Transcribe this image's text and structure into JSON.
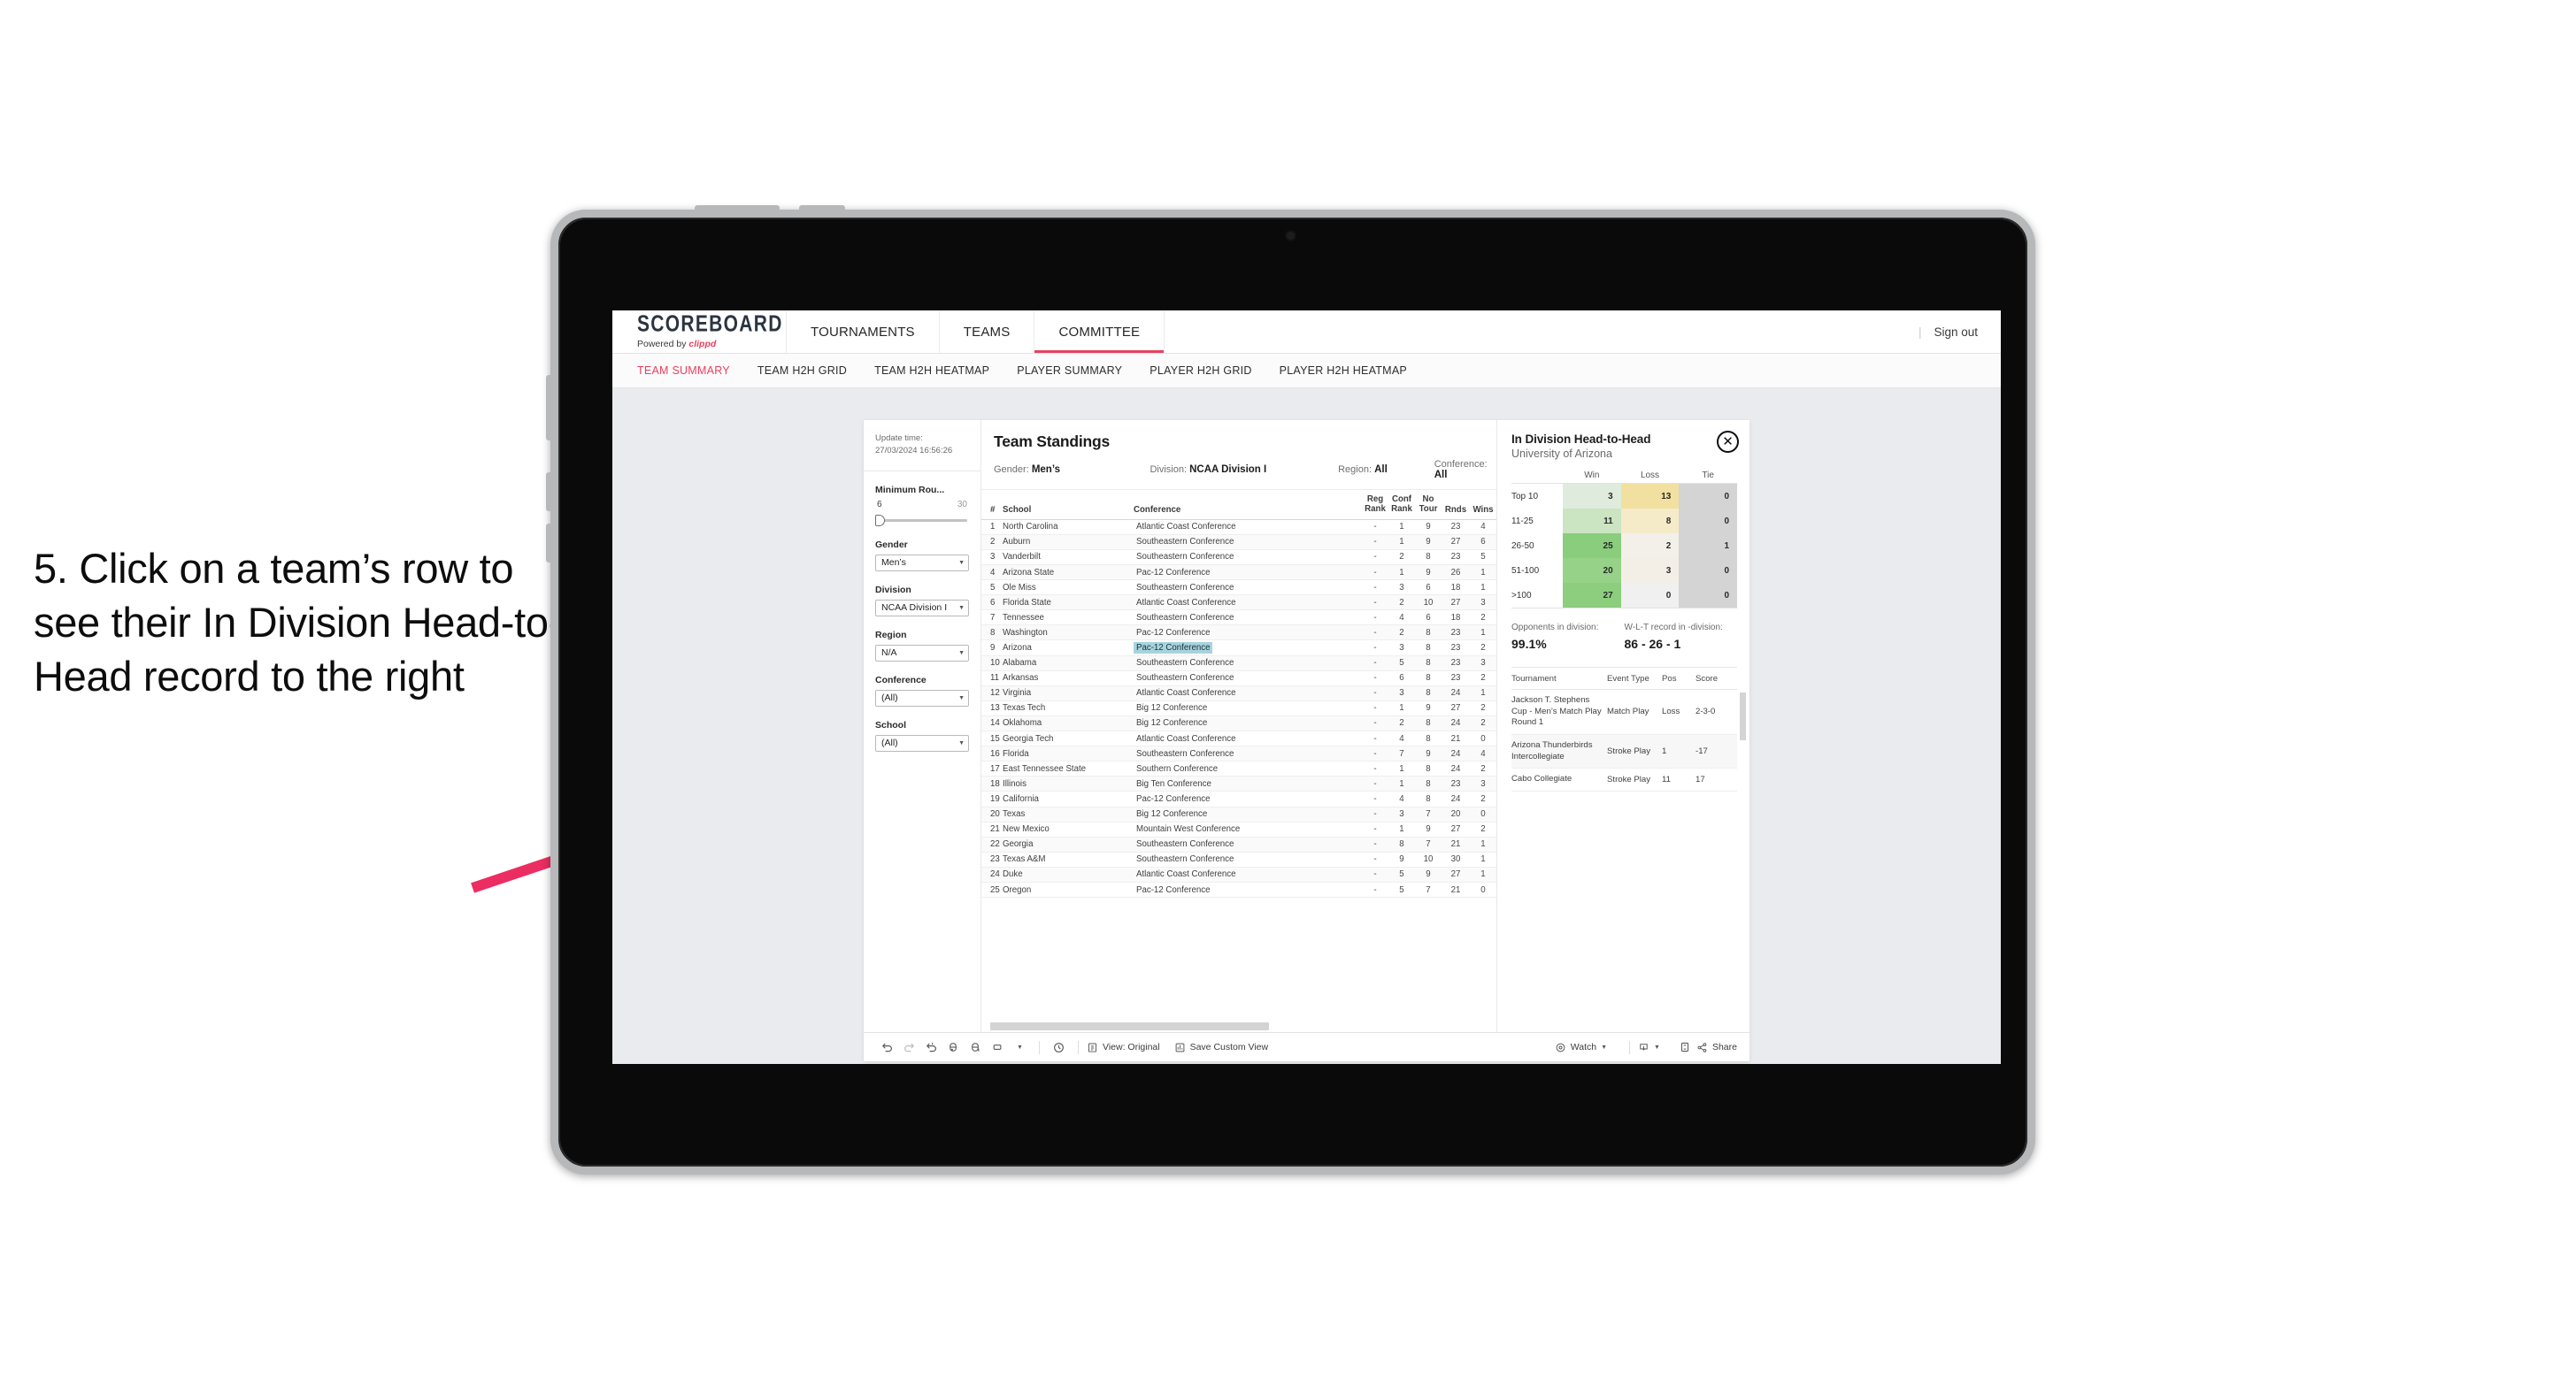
{
  "caption": "5. Click on a team’s row to see their In Division Head-to-Head record to the right",
  "topnav": {
    "brand_name": "SCOREBOARD",
    "brand_sub_prefix": "Powered by ",
    "brand_sub_accent": "clippd",
    "items": [
      {
        "label": "TOURNAMENTS",
        "active": false
      },
      {
        "label": "TEAMS",
        "active": false
      },
      {
        "label": "COMMITTEE",
        "active": true
      }
    ],
    "divider": "|",
    "sign_out": "Sign out"
  },
  "subtabs": [
    {
      "label": "TEAM SUMMARY",
      "active": true
    },
    {
      "label": "TEAM H2H GRID",
      "active": false
    },
    {
      "label": "TEAM H2H HEATMAP",
      "active": false
    },
    {
      "label": "PLAYER SUMMARY",
      "active": false
    },
    {
      "label": "PLAYER H2H GRID",
      "active": false
    },
    {
      "label": "PLAYER H2H HEATMAP",
      "active": false
    }
  ],
  "rail": {
    "update_time_label": "Update time:",
    "update_time_value": "27/03/2024 16:56:26",
    "slider": {
      "label": "Minimum Rou...",
      "min": "6",
      "max": "30"
    },
    "filters": [
      {
        "label": "Gender",
        "value": "Men’s"
      },
      {
        "label": "Division",
        "value": "NCAA Division I"
      },
      {
        "label": "Region",
        "value": "N/A"
      },
      {
        "label": "Conference",
        "value": "(All)"
      },
      {
        "label": "School",
        "value": "(All)"
      }
    ]
  },
  "standings": {
    "title": "Team Standings",
    "filters": [
      {
        "label": "Gender:",
        "value": "Men’s"
      },
      {
        "label": "Division:",
        "value": "NCAA Division I"
      },
      {
        "label": "Region:",
        "value": "All"
      },
      {
        "label": "Conference:",
        "value": "All"
      }
    ],
    "columns": [
      "#",
      "School",
      "Conference",
      "Reg Rank",
      "Conf Rank",
      "No Tour",
      "Rnds",
      "Wins"
    ],
    "columns_two_line": [
      {
        "l1": "",
        "l2": "#"
      },
      {
        "l1": "",
        "l2": "School"
      },
      {
        "l1": "",
        "l2": "Conference"
      },
      {
        "l1": "Reg",
        "l2": "Rank"
      },
      {
        "l1": "Conf",
        "l2": "Rank"
      },
      {
        "l1": "No",
        "l2": "Tour"
      },
      {
        "l1": "",
        "l2": "Rnds"
      },
      {
        "l1": "",
        "l2": "Wins"
      }
    ],
    "rows": [
      {
        "num": "1",
        "school": "North Carolina",
        "conf": "Atlantic Coast Conference",
        "reg": "-",
        "confrank": "1",
        "notour": "9",
        "rnds": "23",
        "wins": "4",
        "selected": false
      },
      {
        "num": "2",
        "school": "Auburn",
        "conf": "Southeastern Conference",
        "reg": "-",
        "confrank": "1",
        "notour": "9",
        "rnds": "27",
        "wins": "6",
        "selected": false
      },
      {
        "num": "3",
        "school": "Vanderbilt",
        "conf": "Southeastern Conference",
        "reg": "-",
        "confrank": "2",
        "notour": "8",
        "rnds": "23",
        "wins": "5",
        "selected": false
      },
      {
        "num": "4",
        "school": "Arizona State",
        "conf": "Pac-12 Conference",
        "reg": "-",
        "confrank": "1",
        "notour": "9",
        "rnds": "26",
        "wins": "1",
        "selected": false
      },
      {
        "num": "5",
        "school": "Ole Miss",
        "conf": "Southeastern Conference",
        "reg": "-",
        "confrank": "3",
        "notour": "6",
        "rnds": "18",
        "wins": "1",
        "selected": false
      },
      {
        "num": "6",
        "school": "Florida State",
        "conf": "Atlantic Coast Conference",
        "reg": "-",
        "confrank": "2",
        "notour": "10",
        "rnds": "27",
        "wins": "3",
        "selected": false
      },
      {
        "num": "7",
        "school": "Tennessee",
        "conf": "Southeastern Conference",
        "reg": "-",
        "confrank": "4",
        "notour": "6",
        "rnds": "18",
        "wins": "2",
        "selected": false
      },
      {
        "num": "8",
        "school": "Washington",
        "conf": "Pac-12 Conference",
        "reg": "-",
        "confrank": "2",
        "notour": "8",
        "rnds": "23",
        "wins": "1",
        "selected": false
      },
      {
        "num": "9",
        "school": "Arizona",
        "conf": "Pac-12 Conference",
        "reg": "-",
        "confrank": "3",
        "notour": "8",
        "rnds": "23",
        "wins": "2",
        "selected": true
      },
      {
        "num": "10",
        "school": "Alabama",
        "conf": "Southeastern Conference",
        "reg": "-",
        "confrank": "5",
        "notour": "8",
        "rnds": "23",
        "wins": "3",
        "selected": false
      },
      {
        "num": "11",
        "school": "Arkansas",
        "conf": "Southeastern Conference",
        "reg": "-",
        "confrank": "6",
        "notour": "8",
        "rnds": "23",
        "wins": "2",
        "selected": false
      },
      {
        "num": "12",
        "school": "Virginia",
        "conf": "Atlantic Coast Conference",
        "reg": "-",
        "confrank": "3",
        "notour": "8",
        "rnds": "24",
        "wins": "1",
        "selected": false
      },
      {
        "num": "13",
        "school": "Texas Tech",
        "conf": "Big 12 Conference",
        "reg": "-",
        "confrank": "1",
        "notour": "9",
        "rnds": "27",
        "wins": "2",
        "selected": false
      },
      {
        "num": "14",
        "school": "Oklahoma",
        "conf": "Big 12 Conference",
        "reg": "-",
        "confrank": "2",
        "notour": "8",
        "rnds": "24",
        "wins": "2",
        "selected": false
      },
      {
        "num": "15",
        "school": "Georgia Tech",
        "conf": "Atlantic Coast Conference",
        "reg": "-",
        "confrank": "4",
        "notour": "8",
        "rnds": "21",
        "wins": "0",
        "selected": false
      },
      {
        "num": "16",
        "school": "Florida",
        "conf": "Southeastern Conference",
        "reg": "-",
        "confrank": "7",
        "notour": "9",
        "rnds": "24",
        "wins": "4",
        "selected": false
      },
      {
        "num": "17",
        "school": "East Tennessee State",
        "conf": "Southern Conference",
        "reg": "-",
        "confrank": "1",
        "notour": "8",
        "rnds": "24",
        "wins": "2",
        "selected": false
      },
      {
        "num": "18",
        "school": "Illinois",
        "conf": "Big Ten Conference",
        "reg": "-",
        "confrank": "1",
        "notour": "8",
        "rnds": "23",
        "wins": "3",
        "selected": false
      },
      {
        "num": "19",
        "school": "California",
        "conf": "Pac-12 Conference",
        "reg": "-",
        "confrank": "4",
        "notour": "8",
        "rnds": "24",
        "wins": "2",
        "selected": false
      },
      {
        "num": "20",
        "school": "Texas",
        "conf": "Big 12 Conference",
        "reg": "-",
        "confrank": "3",
        "notour": "7",
        "rnds": "20",
        "wins": "0",
        "selected": false
      },
      {
        "num": "21",
        "school": "New Mexico",
        "conf": "Mountain West Conference",
        "reg": "-",
        "confrank": "1",
        "notour": "9",
        "rnds": "27",
        "wins": "2",
        "selected": false
      },
      {
        "num": "22",
        "school": "Georgia",
        "conf": "Southeastern Conference",
        "reg": "-",
        "confrank": "8",
        "notour": "7",
        "rnds": "21",
        "wins": "1",
        "selected": false
      },
      {
        "num": "23",
        "school": "Texas A&M",
        "conf": "Southeastern Conference",
        "reg": "-",
        "confrank": "9",
        "notour": "10",
        "rnds": "30",
        "wins": "1",
        "selected": false
      },
      {
        "num": "24",
        "school": "Duke",
        "conf": "Atlantic Coast Conference",
        "reg": "-",
        "confrank": "5",
        "notour": "9",
        "rnds": "27",
        "wins": "1",
        "selected": false
      },
      {
        "num": "25",
        "school": "Oregon",
        "conf": "Pac-12 Conference",
        "reg": "-",
        "confrank": "5",
        "notour": "7",
        "rnds": "21",
        "wins": "0",
        "selected": false
      }
    ]
  },
  "h2h": {
    "title": "In Division Head-to-Head",
    "subtitle": "University of Arizona",
    "close_icon": "✕",
    "columns": [
      "Win",
      "Loss",
      "Tie"
    ],
    "rows": [
      {
        "bucket": "Top 10",
        "win": "3",
        "loss": "13",
        "tie": "0",
        "win_color": "#dfecdd",
        "loss_color": "#f2e0a0",
        "tie_color": "#d4d4d4"
      },
      {
        "bucket": "11-25",
        "win": "11",
        "loss": "8",
        "tie": "0",
        "win_color": "#cbe4c2",
        "loss_color": "#f5ebc8",
        "tie_color": "#d4d4d4"
      },
      {
        "bucket": "26-50",
        "win": "25",
        "loss": "2",
        "tie": "1",
        "win_color": "#89cd7d",
        "loss_color": "#f2f0e9",
        "tie_color": "#d4d4d4"
      },
      {
        "bucket": "51-100",
        "win": "20",
        "loss": "3",
        "tie": "0",
        "win_color": "#96d287",
        "loss_color": "#f3efe6",
        "tie_color": "#d4d4d4"
      },
      {
        "bucket": ">100",
        "win": "27",
        "loss": "0",
        "tie": "0",
        "win_color": "#8ccd7e",
        "loss_color": "#f0f0f0",
        "tie_color": "#d4d4d4"
      }
    ],
    "summary": [
      {
        "caption": "Opponents in division:",
        "value": "99.1%"
      },
      {
        "caption": "W-L-T record in -division:",
        "value": "86 - 26 - 1"
      }
    ],
    "tournaments_columns": [
      "Tournament",
      "Event Type",
      "Pos",
      "Score"
    ],
    "tournaments": [
      {
        "name": "Jackson T. Stephens Cup - Men’s Match Play Round 1",
        "type": "Match Play",
        "pos": "Loss",
        "score": "2-3-0"
      },
      {
        "name": "Arizona Thunderbirds Intercollegiate",
        "type": "Stroke Play",
        "pos": "1",
        "score": "-17"
      },
      {
        "name": "Cabo Collegiate",
        "type": "Stroke Play",
        "pos": "11",
        "score": "17"
      }
    ]
  },
  "toolbar": {
    "icons": [
      "undo-icon",
      "redo-icon",
      "revert-icon",
      "refresh-icon",
      "pause-icon",
      "bookmark-icon",
      "caret-icon",
      "clock-icon"
    ],
    "view_original": "View: Original",
    "save_custom_view": "Save Custom View",
    "watch": "Watch",
    "share": "Share"
  },
  "colors": {
    "accent": "#e8415f",
    "selection": "#a8d3dd",
    "arrow": "#ec2d62"
  }
}
